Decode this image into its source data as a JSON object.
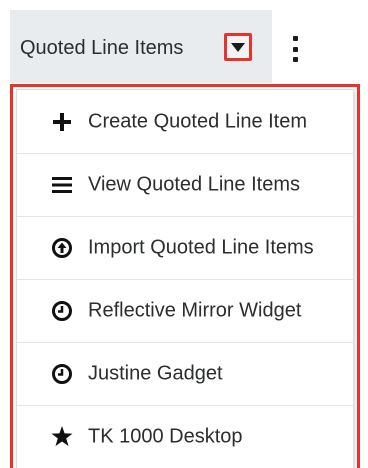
{
  "tab": {
    "label": "Quoted Line Items"
  },
  "menu": {
    "items": [
      {
        "label": "Create Quoted Line Item",
        "icon": "plus-icon"
      },
      {
        "label": "View Quoted Line Items",
        "icon": "list-icon"
      },
      {
        "label": "Import Quoted Line Items",
        "icon": "upload-circle-icon"
      },
      {
        "label": "Reflective Mirror Widget",
        "icon": "clock-icon"
      },
      {
        "label": "Justine Gadget",
        "icon": "clock-icon"
      },
      {
        "label": "TK 1000 Desktop",
        "icon": "star-icon"
      }
    ]
  },
  "colors": {
    "highlight": "#e8332b",
    "tab_background": "#e8ecef",
    "text": "#2b2d2e"
  }
}
